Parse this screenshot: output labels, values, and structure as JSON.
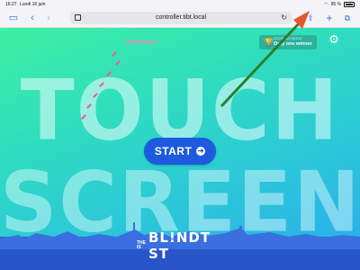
{
  "status_bar": {
    "time": "16:27",
    "date": "Lundi 16 juin",
    "battery": "95 %"
  },
  "browser": {
    "url": "controller.tibt.local",
    "icons": [
      "sidebar-icon",
      "back-icon",
      "forward-icon",
      "tab-icon",
      "reload-icon",
      "share-icon",
      "new-tab-icon",
      "tabs-icon"
    ]
  },
  "page": {
    "big_text_line1": "TOUCH",
    "big_text_line2": "SCREEN",
    "mode": {
      "label": "SCORING MODE",
      "value": "Only one winner"
    },
    "start_button": {
      "label": "START"
    },
    "logo": {
      "prefix_top": "THE",
      "prefix_bottom": "IS",
      "name": "BL!NDT  ST"
    }
  },
  "colors": {
    "accent": "#1d5ae0",
    "gradient_top": "#3df0a2",
    "gradient_bottom": "#2aa9f0",
    "annotation_arrow": "#2e7d2e"
  }
}
